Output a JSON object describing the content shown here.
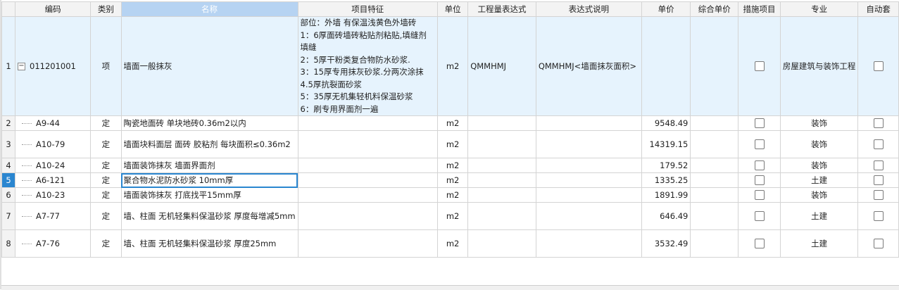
{
  "headers": {
    "rownum": "",
    "code": "编码",
    "type": "类别",
    "name": "名称",
    "feature": "项目特征",
    "unit": "单位",
    "expr": "工程量表达式",
    "expr_desc": "表达式说明",
    "price": "单价",
    "unit_total": "综合单价",
    "measure": "措施项目",
    "major": "专业",
    "auto": "自动套"
  },
  "parent_row": {
    "num": "1",
    "code": "011201001",
    "type": "项",
    "name": "墙面一般抹灰",
    "feature_lines": [
      "部位：外墙 有保温浅黄色外墙砖",
      "1：6厚面砖墙砖粘贴剂粘贴,填缝剂",
      "填缝",
      "2：5厚干粉类复合物防水砂浆.",
      "3：15厚专用抹灰砂浆.分两次涂抹",
      "4.5厚抗裂面砂浆",
      "5：35厚无机集轻机料保温砂浆",
      "6：刷专用界面剂一遍"
    ],
    "unit": "m2",
    "expr": "QMMHMJ",
    "expr_desc": "QMMHMJ<墙面抹灰面积>",
    "price": "",
    "unit_total": "",
    "major": "房屋建筑与装饰工程"
  },
  "rows": [
    {
      "num": "2",
      "code": "A9-44",
      "type": "定",
      "name": "陶瓷地面砖 单块地砖0.36m2以内",
      "unit": "m2",
      "price": "9548.49",
      "major": "装饰"
    },
    {
      "num": "3",
      "code": "A10-79",
      "type": "定",
      "name": "墙面块料面层 面砖 胶粘剂 每块面积≤0.36m2",
      "unit": "m2",
      "price": "14319.15",
      "major": "装饰"
    },
    {
      "num": "4",
      "code": "A10-24",
      "type": "定",
      "name": "墙面装饰抹灰 墙面界面剂",
      "unit": "m2",
      "price": "179.52",
      "major": "装饰"
    },
    {
      "num": "5",
      "code": "A6-121",
      "type": "定",
      "name": "聚合物水泥防水砂浆 10mm厚",
      "unit": "m2",
      "price": "1335.25",
      "major": "土建"
    },
    {
      "num": "6",
      "code": "A10-23",
      "type": "定",
      "name": "墙面装饰抹灰 打底找平15mm厚",
      "unit": "m2",
      "price": "1891.99",
      "major": "装饰"
    },
    {
      "num": "7",
      "code": "A7-77",
      "type": "定",
      "name": "墙、柱面 无机轻集料保温砂浆 厚度每增减5mm",
      "unit": "m2",
      "price": "646.49",
      "major": "土建"
    },
    {
      "num": "8",
      "code": "A7-76",
      "type": "定",
      "name": "墙、柱面 无机轻集料保温砂浆 厚度25mm",
      "unit": "m2",
      "price": "3532.49",
      "major": "土建"
    }
  ],
  "selected_row": "5",
  "colors": {
    "header_bg": "#f3f3f3",
    "selected_header": "#b6d3f2",
    "parent_bg": "#e6f3fd",
    "selection": "#2a86d0"
  }
}
